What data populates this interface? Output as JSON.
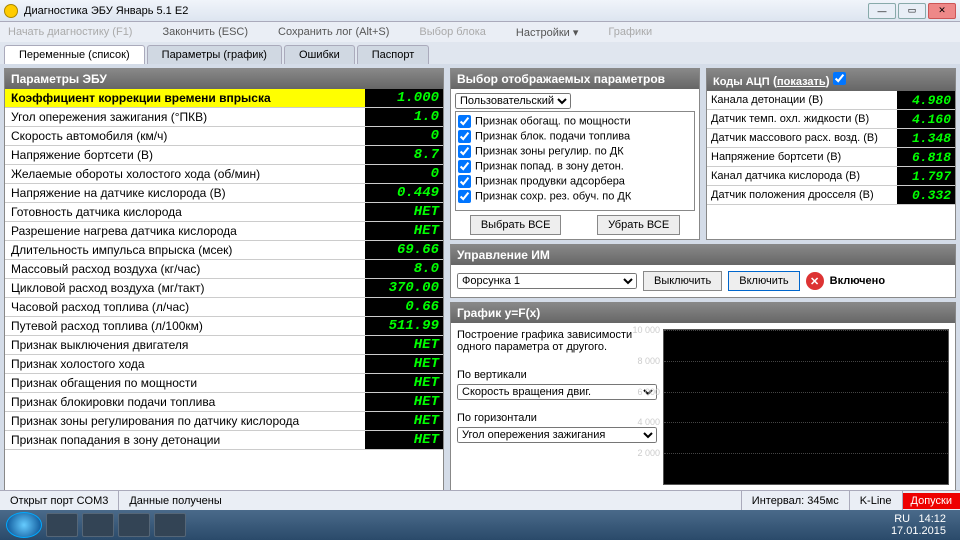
{
  "window": {
    "title": "Диагностика ЭБУ Январь 5.1 E2"
  },
  "menu": {
    "start": "Начать диагностику (F1)",
    "end": "Закончить (ESC)",
    "save": "Сохранить лог (Alt+S)",
    "block": "Выбор блока",
    "settings": "Настройки",
    "charts": "Графики"
  },
  "tabs": {
    "t1": "Переменные (список)",
    "t2": "Параметры (график)",
    "t3": "Ошибки",
    "t4": "Паспорт"
  },
  "params_header": "Параметры ЭБУ",
  "params": [
    {
      "label": "Коэффициент коррекции времени впрыска",
      "value": "1.000",
      "hl": true
    },
    {
      "label": "Угол опережения зажигания (°ПКВ)",
      "value": "1.0"
    },
    {
      "label": "Скорость автомобиля (км/ч)",
      "value": "0"
    },
    {
      "label": "Напряжение бортсети (В)",
      "value": "8.7"
    },
    {
      "label": "Желаемые обороты холостого хода (об/мин)",
      "value": "0"
    },
    {
      "label": "Напряжение на датчике кислорода (В)",
      "value": "0.449"
    },
    {
      "label": "Готовность датчика кислорода",
      "value": "НЕТ"
    },
    {
      "label": "Разрешение нагрева датчика кислорода",
      "value": "НЕТ"
    },
    {
      "label": "Длительность импульса впрыска (мсек)",
      "value": "69.66"
    },
    {
      "label": "Массовый расход воздуха (кг/час)",
      "value": "8.0"
    },
    {
      "label": "Цикловой расход воздуха (мг/такт)",
      "value": "370.00"
    },
    {
      "label": "Часовой расход топлива (л/час)",
      "value": "0.66"
    },
    {
      "label": "Путевой расход топлива (л/100км)",
      "value": "511.99"
    },
    {
      "label": "Признак выключения двигателя",
      "value": "НЕТ"
    },
    {
      "label": "Признак холостого хода",
      "value": "НЕТ"
    },
    {
      "label": "Признак обгащения по мощности",
      "value": "НЕТ"
    },
    {
      "label": "Признак блокировки подачи топлива",
      "value": "НЕТ"
    },
    {
      "label": "Признак зоны регулирования по датчику кислорода",
      "value": "НЕТ"
    },
    {
      "label": "Признак попадания в зону детонации",
      "value": "НЕТ"
    }
  ],
  "selparams": {
    "header": "Выбор отображаемых параметров",
    "preset": "Пользовательский",
    "items": [
      "Признак обогащ. по мощности",
      "Признак блок. подачи топлива",
      "Признак зоны регулир. по ДК",
      "Признак попад. в зону детон.",
      "Признак продувки адсорбера",
      "Признак сохр. рез. обуч. по ДК"
    ],
    "select_all": "Выбрать ВСЕ",
    "remove_all": "Убрать ВСЕ"
  },
  "adc": {
    "header": "Коды АЦП",
    "show": "показать",
    "rows": [
      {
        "label": "Канала детонации (В)",
        "value": "4.980"
      },
      {
        "label": "Датчик темп. охл. жидкости (В)",
        "value": "4.160"
      },
      {
        "label": "Датчик массового расх. возд. (В)",
        "value": "1.348"
      },
      {
        "label": "Напряжение бортсети (В)",
        "value": "6.818"
      },
      {
        "label": "Канал датчика кислорода (В)",
        "value": "1.797"
      },
      {
        "label": "Датчик положения дросселя (В)",
        "value": "0.332"
      }
    ]
  },
  "ctrl": {
    "header": "Управление ИМ",
    "target": "Форсунка 1",
    "off": "Выключить",
    "on": "Включить",
    "state": "Включено"
  },
  "graph": {
    "header": "График y=F(x)",
    "desc": "Построение графика зависимости одного параметра от другого.",
    "vlabel": "По вертикали",
    "vsel": "Скорость вращения двиг.",
    "hlabel": "По горизонтали",
    "hsel": "Угол опережения зажигания"
  },
  "status": {
    "port": "Открыт порт COM3",
    "data": "Данные получены",
    "interval": "Интервал: 345мс",
    "kline": "K-Line",
    "dopuski": "Допуски"
  },
  "tray": {
    "lang": "RU",
    "time": "14:12",
    "date": "17.01.2015"
  },
  "chart_data": {
    "type": "line",
    "title": "y=F(x)",
    "xlabel": "Угол опережения зажигания",
    "ylabel": "Скорость вращения двиг.",
    "ylim": [
      0,
      10000
    ],
    "yticks": [
      2000,
      4000,
      6000,
      8000,
      10000
    ],
    "series": [
      {
        "name": "y",
        "values": []
      }
    ]
  }
}
